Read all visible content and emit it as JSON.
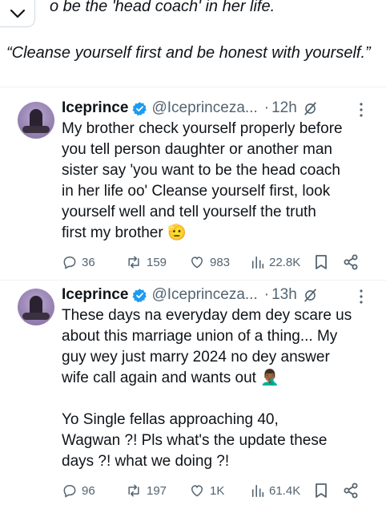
{
  "quote_fragment": {
    "line1": "o be the 'head coach' in her life.",
    "line2": "“Cleanse yourself first and be honest with yourself.”"
  },
  "tweets": [
    {
      "name": "Iceprince",
      "handle": "@Iceprinceza...",
      "dot": "·",
      "time": "12h",
      "text": "My brother check yourself properly before\nyou tell person daughter or another man\nsister say 'you want to be the head coach\nin her life oo'  Cleanse yourself first, look\nyourself well and tell yourself the truth\nfirst my brother 🫡",
      "replies": "36",
      "reposts": "159",
      "likes": "983",
      "views": "22.8K"
    },
    {
      "name": "Iceprince",
      "handle": "@Iceprinceza...",
      "dot": "·",
      "time": "13h",
      "text": "These days na everyday dem dey scare us\nabout this marriage union of a thing... My\nguy wey just marry 2024 no dey answer\nwife call again and wants out 🤦🏾‍♂️\n\nYo Single fellas approaching 40,\nWagwan ?! Pls what's the update these\ndays ?! what we doing ?!",
      "replies": "96",
      "reposts": "197",
      "likes": "1K",
      "views": "61.4K"
    }
  ],
  "colors": {
    "verified": "#1d9bf0",
    "muted": "#536471",
    "text": "#0f1419",
    "divider": "#eff3f4"
  },
  "icons": [
    "chevron-down-icon",
    "verified-badge-icon",
    "grok-icon",
    "more-icon",
    "reply-icon",
    "repost-icon",
    "like-icon",
    "views-icon",
    "bookmark-icon",
    "share-icon"
  ]
}
